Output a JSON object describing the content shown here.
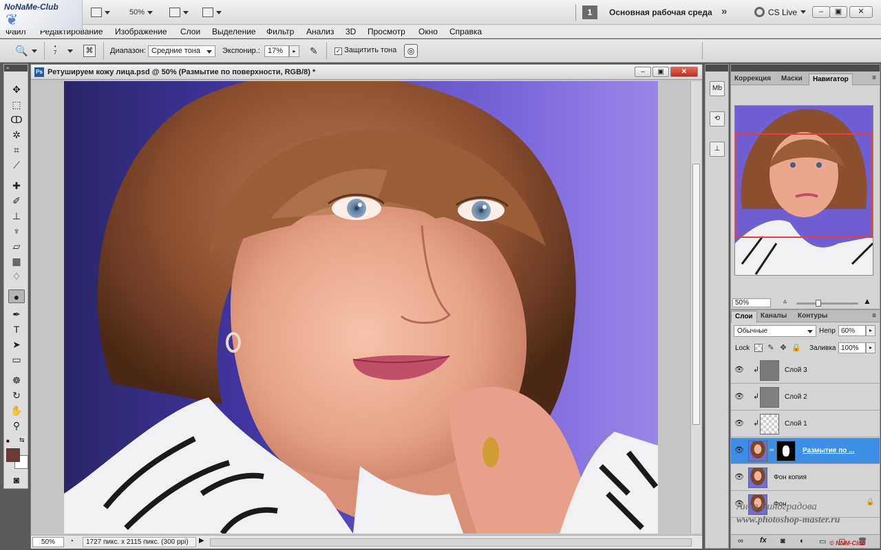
{
  "appbar": {
    "logo_text": "NoNaMe-Club",
    "zoom": "50%",
    "workspace_number": "1",
    "workspace_name": "Основная рабочая среда",
    "cslive": "CS Live"
  },
  "menu": [
    "Файл",
    "Редактирование",
    "Изображение",
    "Слои",
    "Выделение",
    "Фильтр",
    "Анализ",
    "3D",
    "Просмотр",
    "Окно",
    "Справка"
  ],
  "options": {
    "brush_size": "7",
    "range_label": "Диапазон:",
    "range_value": "Средние тона",
    "exposure_label": "Экспонир.:",
    "exposure_value": "17%",
    "protect_label": "Защитить тона"
  },
  "document": {
    "title": "Ретушируем кожу лица.psd @ 50% (Размытие по поверхности, RGB/8) *",
    "zoom": "50%",
    "info": "1727 пикс. x 2115 пикс. (300 ppi)"
  },
  "colors": {
    "foreground": "#6e3a33",
    "background": "#ffffff",
    "selected_layer": "#3d8ee6"
  },
  "navigator": {
    "tabs": [
      "Коррекция",
      "Маски",
      "Навигатор"
    ],
    "active_tab": "Навигатор",
    "zoom": "50%"
  },
  "layers_panel": {
    "tabs": [
      "Слои",
      "Каналы",
      "Контуры"
    ],
    "active_tab": "Слои",
    "blend_mode": "Обычные",
    "opacity_label": "Непр",
    "opacity": "60%",
    "lock_label": "Lock",
    "fill_label": "Заливка",
    "fill": "100%",
    "layers": [
      {
        "name": "Слой 3",
        "type": "gray",
        "clipped": true,
        "selected": false
      },
      {
        "name": "Слой 2",
        "type": "gray",
        "clipped": true,
        "selected": false
      },
      {
        "name": "Слой 1",
        "type": "transparent",
        "clipped": true,
        "selected": false
      },
      {
        "name": "Размытие по ...",
        "type": "photo-mask",
        "clipped": false,
        "selected": true
      },
      {
        "name": "Фон копия",
        "type": "photo",
        "clipped": false,
        "selected": false
      },
      {
        "name": "Фон",
        "type": "photo",
        "clipped": false,
        "selected": false,
        "locked": true
      }
    ]
  },
  "watermark": {
    "line1": "Анна Виноградова",
    "line2": "www.photoshop-master.ru",
    "club": "© NNM-Club"
  }
}
